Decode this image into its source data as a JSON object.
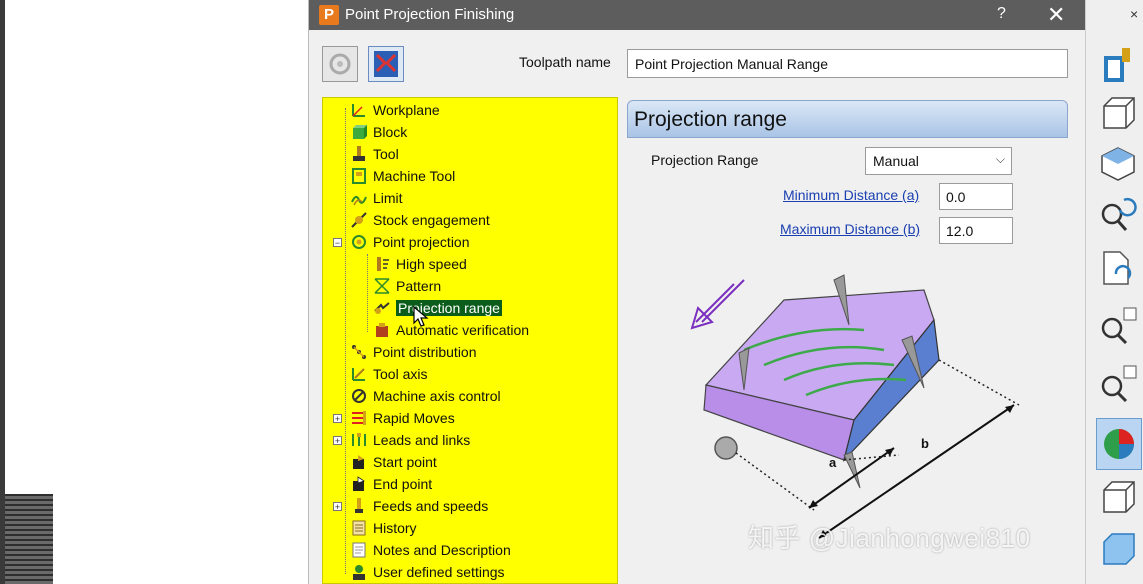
{
  "dialog": {
    "title": "Point Projection Finishing",
    "app_icon": "P",
    "help": "?",
    "close": "✕"
  },
  "toolbar": {
    "toolpath_name_label": "Toolpath name",
    "toolpath_name_value": "Point Projection Manual Range"
  },
  "tree": {
    "items": [
      {
        "label": "Workplane",
        "icon": "workplane-icon"
      },
      {
        "label": "Block",
        "icon": "block-icon"
      },
      {
        "label": "Tool",
        "icon": "tool-icon"
      },
      {
        "label": "Machine Tool",
        "icon": "machine-tool-icon"
      },
      {
        "label": "Limit",
        "icon": "limit-icon"
      },
      {
        "label": "Stock engagement",
        "icon": "stock-engagement-icon"
      },
      {
        "label": "Point projection",
        "icon": "point-projection-icon"
      },
      {
        "label": "High speed",
        "icon": "high-speed-icon"
      },
      {
        "label": "Pattern",
        "icon": "pattern-icon"
      },
      {
        "label": "Projection range",
        "icon": "projection-range-icon"
      },
      {
        "label": "Automatic verification",
        "icon": "automatic-verification-icon"
      },
      {
        "label": "Point distribution",
        "icon": "point-distribution-icon"
      },
      {
        "label": "Tool axis",
        "icon": "tool-axis-icon"
      },
      {
        "label": "Machine axis control",
        "icon": "machine-axis-control-icon"
      },
      {
        "label": "Rapid Moves",
        "icon": "rapid-moves-icon"
      },
      {
        "label": "Leads and links",
        "icon": "leads-links-icon"
      },
      {
        "label": "Start point",
        "icon": "start-point-icon"
      },
      {
        "label": "End point",
        "icon": "end-point-icon"
      },
      {
        "label": "Feeds and speeds",
        "icon": "feeds-speeds-icon"
      },
      {
        "label": "History",
        "icon": "history-icon"
      },
      {
        "label": "Notes and Description",
        "icon": "notes-icon"
      },
      {
        "label": "User defined settings",
        "icon": "user-settings-icon"
      }
    ],
    "selected": "Projection range",
    "colors": {
      "highlight": "#ffff00",
      "selected": "#0a5d1a"
    }
  },
  "panel": {
    "title": "Projection range",
    "projection_range_label": "Projection Range",
    "projection_range_value": "Manual",
    "min_label": "Minimum Distance (a)",
    "min_value": "0.0",
    "max_label": "Maximum Distance (b)",
    "max_value": "12.0",
    "diagram_label_a": "a",
    "diagram_label_b": "b"
  },
  "right_toolbar": {
    "close": "×"
  },
  "watermark": "知乎 @Jianhongwei810"
}
